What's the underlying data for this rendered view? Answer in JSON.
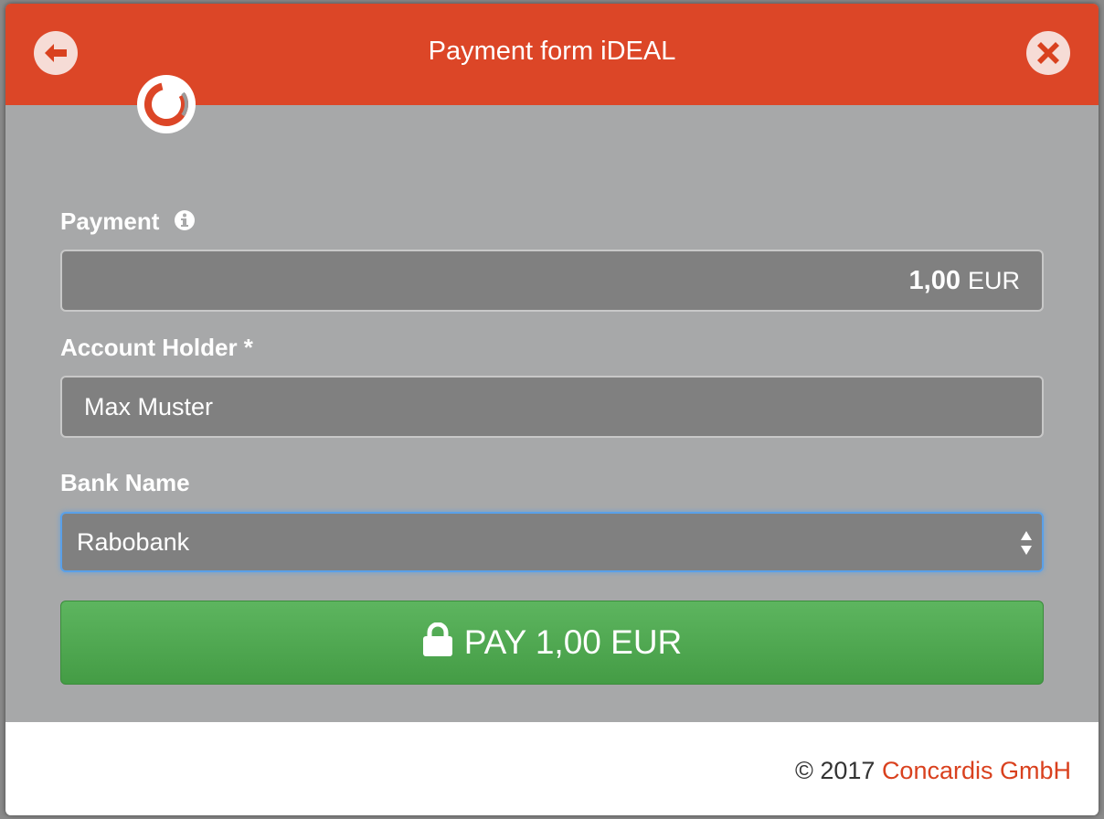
{
  "header": {
    "title": "Payment form iDEAL",
    "back_icon": "arrow-left-icon",
    "close_icon": "close-icon",
    "brand_color": "#dc4627"
  },
  "logo": {
    "icon": "concardis-logo-icon"
  },
  "payment": {
    "label": "Payment",
    "info_icon": "info-icon",
    "amount": "1,00",
    "currency": "EUR"
  },
  "account_holder": {
    "label": "Account Holder *",
    "value": "Max Muster"
  },
  "bank": {
    "label": "Bank Name",
    "selected": "Rabobank"
  },
  "pay_button": {
    "label": "PAY 1,00 EUR",
    "icon": "lock-icon",
    "color": "#4cab4e"
  },
  "footer": {
    "copyright": "© 2017",
    "company": "Concardis GmbH",
    "link_color": "#d9411e"
  }
}
